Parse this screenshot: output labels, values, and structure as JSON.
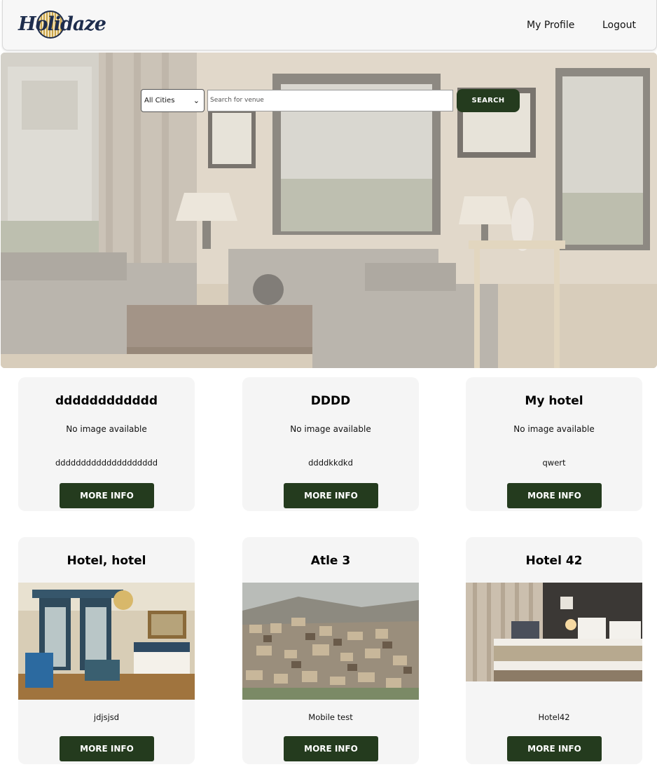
{
  "header": {
    "logo_text": "Holidaze",
    "nav": {
      "profile": "My Profile",
      "logout": "Logout"
    }
  },
  "search": {
    "city_selected": "All Cities",
    "placeholder": "Search for venue",
    "button": "SEARCH"
  },
  "venues": [
    {
      "title": "dddddddddddd",
      "image_text": "No image available",
      "description": "dddddddddddddddddddd",
      "button": "MORE INFO"
    },
    {
      "title": "DDDD",
      "image_text": "No image available",
      "description": "ddddkkdkd",
      "button": "MORE INFO"
    },
    {
      "title": "My hotel",
      "image_text": "No image available",
      "description": "qwert",
      "button": "MORE INFO"
    },
    {
      "title": "Hotel, hotel",
      "image": "classic-hotel-room-photo",
      "description": "jdjsjsd",
      "button": "MORE INFO"
    },
    {
      "title": "Atle 3",
      "image": "hillside-city-photo",
      "description": "Mobile test",
      "button": "MORE INFO"
    },
    {
      "title": "Hotel 42",
      "image": "modern-hotel-bedroom-photo",
      "description": "Hotel42",
      "button": "MORE INFO"
    }
  ],
  "colors": {
    "accent": "#243b1e",
    "card_bg": "#f5f5f5",
    "header_bg": "#f7f7f7"
  }
}
